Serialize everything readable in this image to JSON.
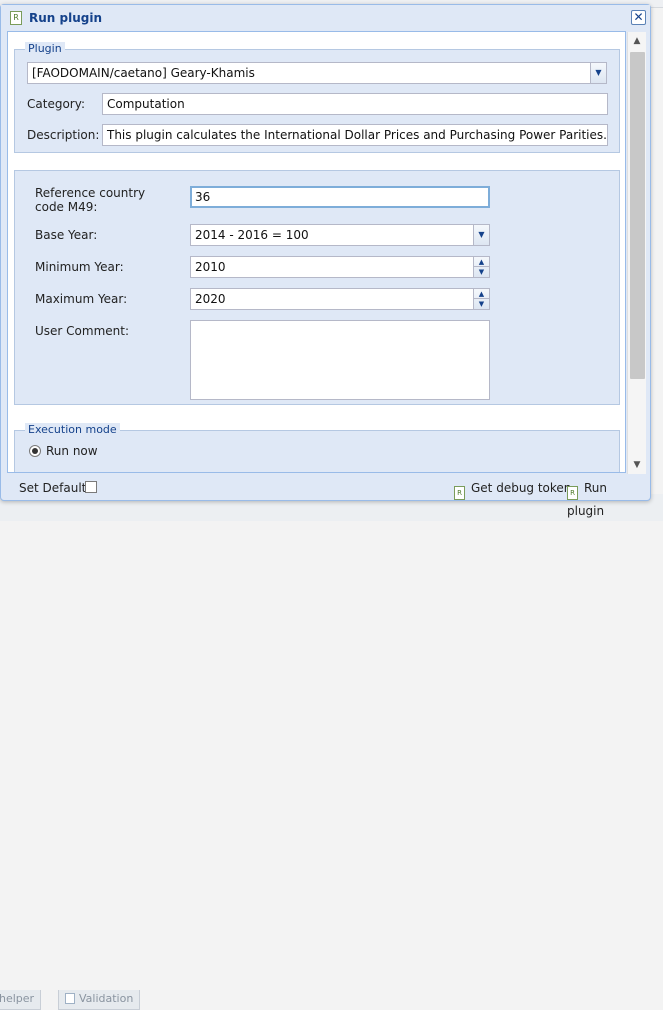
{
  "window": {
    "title": "Run plugin"
  },
  "plugin_section": {
    "legend": "Plugin",
    "selected_plugin": "[FAODOMAIN/caetano] Geary-Khamis",
    "category_label": "Category:",
    "category_value": "Computation",
    "description_label": "Description:",
    "description_value": "This plugin calculates the International Dollar Prices and Purchasing Power Parities."
  },
  "params": {
    "ref_country_label": "Reference country code M49:",
    "ref_country_value": "36",
    "base_year_label": "Base Year:",
    "base_year_value": "2014 - 2016 = 100",
    "min_year_label": "Minimum Year:",
    "min_year_value": "2010",
    "max_year_label": "Maximum Year:",
    "max_year_value": "2020",
    "comment_label": "User Comment:",
    "comment_value": ""
  },
  "execution": {
    "legend": "Execution mode",
    "run_now_label": "Run now",
    "run_now_checked": true
  },
  "footer": {
    "set_default_label": "Set Default:",
    "debug_token_label": "Get debug token",
    "run_plugin_label": "Run plugin"
  },
  "background_tabs": [
    "helper",
    "Validation"
  ],
  "colors": {
    "title": "#15428b",
    "window_bg": "#dfe8f6",
    "border": "#99bbe8"
  }
}
